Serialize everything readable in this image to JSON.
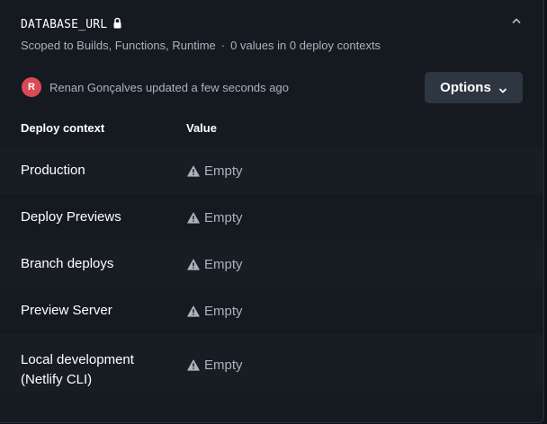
{
  "variable": {
    "name": "DATABASE_URL",
    "lock_icon": "lock-icon",
    "collapse_icon": "chevron-up-icon"
  },
  "subtitle": {
    "scope": "Scoped to Builds, Functions, Runtime",
    "separator": "·",
    "values_summary": "0 values in 0 deploy contexts"
  },
  "updated": {
    "avatar_initial": "R",
    "avatar_color": "#d84b55",
    "text": "Renan Gonçalves updated a few seconds ago"
  },
  "options_button": {
    "label": "Options",
    "icon": "chevron-down-icon"
  },
  "table": {
    "headers": {
      "context": "Deploy context",
      "value": "Value"
    },
    "rows": [
      {
        "context": "Production",
        "context_line2": "",
        "value": "Empty",
        "icon": "warning-icon"
      },
      {
        "context": "Deploy Previews",
        "context_line2": "",
        "value": "Empty",
        "icon": "warning-icon"
      },
      {
        "context": "Branch deploys",
        "context_line2": "",
        "value": "Empty",
        "icon": "warning-icon"
      },
      {
        "context": "Preview Server",
        "context_line2": "",
        "value": "Empty",
        "icon": "warning-icon"
      },
      {
        "context": "Local development",
        "context_line2": "(Netlify CLI)",
        "value": "Empty",
        "icon": "warning-icon"
      }
    ]
  },
  "colors": {
    "background": "#151a21",
    "row_stripe": "#181d24",
    "muted_text": "#aab2bc",
    "button_bg": "#2e3641"
  }
}
